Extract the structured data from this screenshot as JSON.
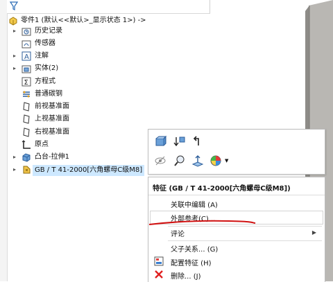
{
  "tree": {
    "root": {
      "label": "零件1  (默认<<默认>_显示状态 1>) ->"
    },
    "items": [
      {
        "label": "历史记录",
        "expandable": true,
        "icon": "history-folder-icon"
      },
      {
        "label": "传感器",
        "expandable": false,
        "icon": "sensor-icon"
      },
      {
        "label": "注解",
        "expandable": true,
        "icon": "annotation-icon"
      },
      {
        "label": "实体(2)",
        "expandable": true,
        "icon": "solid-bodies-icon"
      },
      {
        "label": "方程式",
        "expandable": false,
        "icon": "equations-icon"
      },
      {
        "label": "普通碳钢",
        "expandable": false,
        "icon": "material-icon"
      },
      {
        "label": "前视基准面",
        "expandable": false,
        "icon": "plane-icon"
      },
      {
        "label": "上视基准面",
        "expandable": false,
        "icon": "plane-icon"
      },
      {
        "label": "右视基准面",
        "expandable": false,
        "icon": "plane-icon"
      },
      {
        "label": "原点",
        "expandable": false,
        "icon": "origin-icon"
      },
      {
        "label": "凸台-拉伸1",
        "expandable": true,
        "icon": "boss-extrude-icon"
      },
      {
        "label": "GB / T 41-2000[六角螺母C级M8]",
        "expandable": true,
        "icon": "library-feature-icon",
        "selected": true
      }
    ]
  },
  "context_menu": {
    "header": "特征 (GB / T 41-2000[六角螺母C级M8])",
    "items": [
      {
        "label": "关联中编辑 (A)"
      },
      {
        "label": "外部参考(C)..."
      },
      {
        "label": "评论",
        "submenu": true
      },
      {
        "label": "父子关系... (G)"
      },
      {
        "label": "配置特征 (H)"
      },
      {
        "label": "删除... (J)"
      }
    ]
  },
  "colors": {
    "selection": "#cde8ff",
    "annotation_line": "#d01010",
    "part_face": "#b8b6b2"
  }
}
